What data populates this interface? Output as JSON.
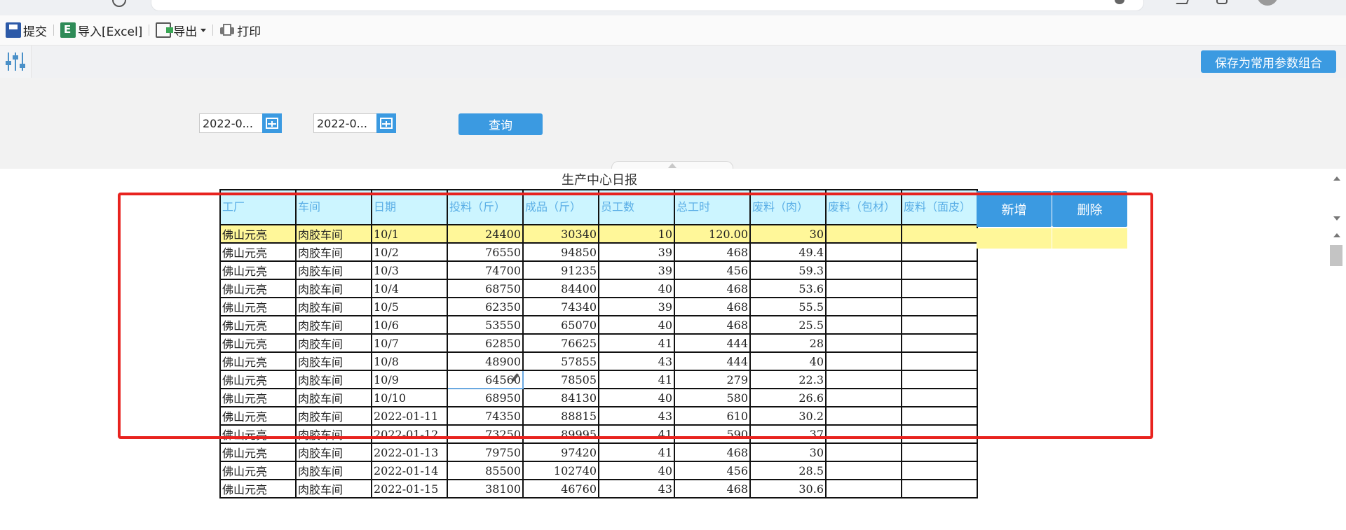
{
  "toolbar": {
    "submit_label": "提交",
    "import_label": "导入[Excel]",
    "export_label": "导出",
    "print_label": "打印"
  },
  "param_bar": {
    "save_params_label": "保存为常用参数组合"
  },
  "query": {
    "start_date": "2022-0...",
    "end_date": "2022-0...",
    "query_label": "查询"
  },
  "report": {
    "title": "生产中心日报",
    "columns": [
      "工厂",
      "车间",
      "日期",
      "投料（斤）",
      "成品（斤）",
      "员工数",
      "总工时",
      "废料（肉）",
      "废料（包材）",
      "废料（面皮）"
    ],
    "rows": [
      [
        "佛山元亮",
        "肉胶车间",
        "10/1",
        "24400",
        "30340",
        "10",
        "120.00",
        "30",
        "",
        ""
      ],
      [
        "佛山元亮",
        "肉胶车间",
        "10/2",
        "76550",
        "94850",
        "39",
        "468",
        "49.4",
        "",
        ""
      ],
      [
        "佛山元亮",
        "肉胶车间",
        "10/3",
        "74700",
        "91235",
        "39",
        "456",
        "59.3",
        "",
        ""
      ],
      [
        "佛山元亮",
        "肉胶车间",
        "10/4",
        "68750",
        "84400",
        "40",
        "468",
        "53.6",
        "",
        ""
      ],
      [
        "佛山元亮",
        "肉胶车间",
        "10/5",
        "62350",
        "74340",
        "39",
        "468",
        "55.5",
        "",
        ""
      ],
      [
        "佛山元亮",
        "肉胶车间",
        "10/6",
        "53550",
        "65070",
        "40",
        "468",
        "25.5",
        "",
        ""
      ],
      [
        "佛山元亮",
        "肉胶车间",
        "10/7",
        "62850",
        "76625",
        "41",
        "444",
        "28",
        "",
        ""
      ],
      [
        "佛山元亮",
        "肉胶车间",
        "10/8",
        "48900",
        "57855",
        "43",
        "444",
        "40",
        "",
        ""
      ],
      [
        "佛山元亮",
        "肉胶车间",
        "10/9",
        "64560",
        "78505",
        "41",
        "279",
        "22.3",
        "",
        ""
      ],
      [
        "佛山元亮",
        "肉胶车间",
        "10/10",
        "68950",
        "84130",
        "40",
        "580",
        "26.6",
        "",
        ""
      ],
      [
        "佛山元亮",
        "肉胶车间",
        "2022-01-11",
        "74350",
        "88815",
        "43",
        "610",
        "30.2",
        "",
        ""
      ],
      [
        "佛山元亮",
        "肉胶车间",
        "2022-01-12",
        "73250",
        "89995",
        "41",
        "590",
        "37",
        "",
        ""
      ],
      [
        "佛山元亮",
        "肉胶车间",
        "2022-01-13",
        "79750",
        "97420",
        "41",
        "468",
        "30",
        "",
        ""
      ],
      [
        "佛山元亮",
        "肉胶车间",
        "2022-01-14",
        "85500",
        "102740",
        "40",
        "456",
        "28.5",
        "",
        ""
      ],
      [
        "佛山元亮",
        "肉胶车间",
        "2022-01-15",
        "38100",
        "46760",
        "43",
        "468",
        "30.6",
        "",
        ""
      ]
    ],
    "add_label": "新增",
    "delete_label": "删除"
  },
  "colors": {
    "accent": "#3b9ae1",
    "header_bg": "#ccf5ff",
    "header_text": "#5aaee6",
    "selected_row": "#fff799",
    "highlight_border": "#e8231f"
  },
  "icons": [
    "save-icon",
    "excel-icon",
    "export-icon",
    "print-icon",
    "filter-sliders-icon",
    "calendar-icon",
    "pencil-icon"
  ]
}
